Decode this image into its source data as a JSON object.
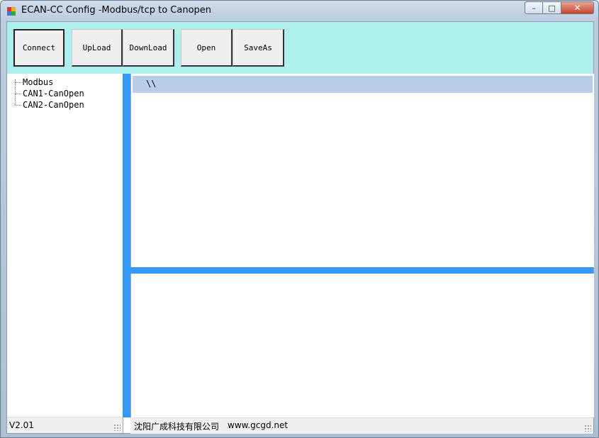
{
  "window": {
    "title": "ECAN-CC Config -Modbus/tcp to Canopen",
    "controls": {
      "minimize": "–",
      "maximize": "□",
      "close": "✕"
    }
  },
  "toolbar": {
    "buttons": [
      {
        "label": "Connect"
      },
      {
        "label": "UpLoad"
      },
      {
        "label": "DownLoad"
      },
      {
        "label": "Open"
      },
      {
        "label": "SaveAs"
      }
    ],
    "background": "#b0eeee"
  },
  "tree": {
    "items": [
      "Modbus",
      "CAN1-CanOpen",
      "CAN2-CanOpen"
    ]
  },
  "editor": {
    "path": "\\\\"
  },
  "status": {
    "version": "V2.01",
    "company": "沈阳广成科技有限公司",
    "website": "www.gcgd.net"
  },
  "colors": {
    "splitter": "#3399ff",
    "selected_row": "#b8cde8"
  }
}
